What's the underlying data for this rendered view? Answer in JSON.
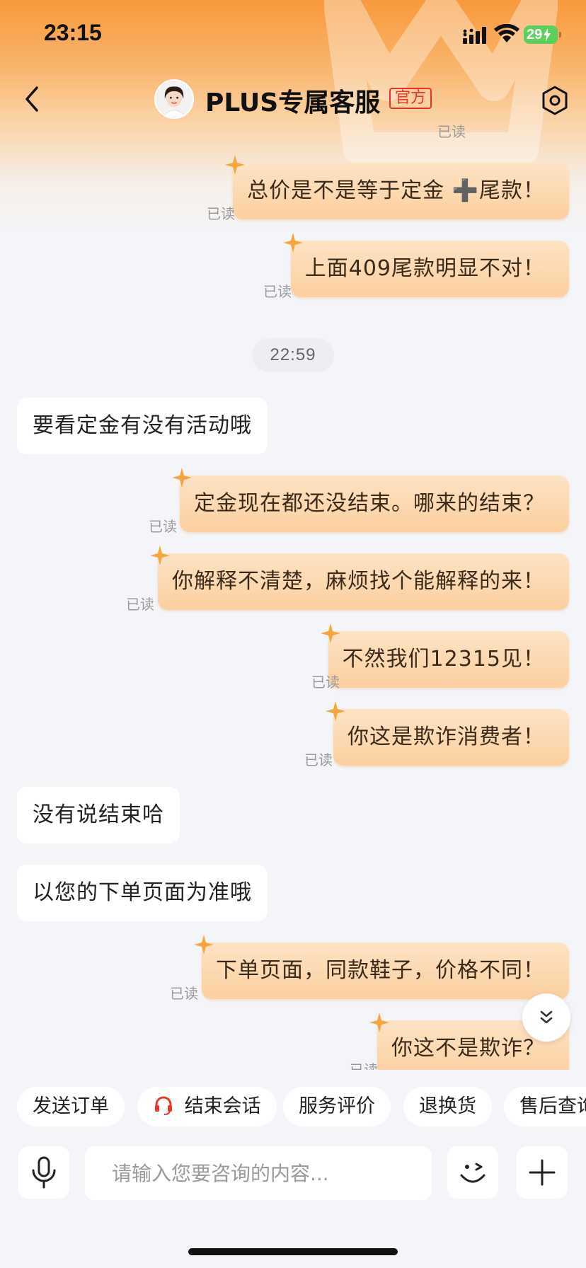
{
  "status_bar": {
    "time": "23:15",
    "battery": "29"
  },
  "header": {
    "title": "PLUS专属客服",
    "badge": "官方"
  },
  "chat": {
    "messages": [
      {
        "type": "out",
        "text": "总价是不是等于定金 ➕尾款！",
        "read": "已读"
      },
      {
        "type": "out",
        "text": "上面409尾款明显不对！",
        "read": "已读"
      },
      {
        "type": "time",
        "text": "22:59"
      },
      {
        "type": "in",
        "text": "要看定金有没有活动哦"
      },
      {
        "type": "out",
        "text": "定金现在都还没结束。哪来的结束？",
        "read": "已读"
      },
      {
        "type": "out",
        "text": "你解释不清楚，麻烦找个能解释的来！",
        "read": "已读"
      },
      {
        "type": "out",
        "text": "不然我们12315见！",
        "read": "已读"
      },
      {
        "type": "out",
        "text": "你这是欺诈消费者！",
        "read": "已读"
      },
      {
        "type": "in",
        "text": "没有说结束哈"
      },
      {
        "type": "in",
        "text": "以您的下单页面为准哦"
      },
      {
        "type": "out",
        "text": "下单页面，同款鞋子，价格不同！",
        "read": "已读"
      },
      {
        "type": "out",
        "text": "你这不是欺诈？",
        "read": "已读"
      }
    ],
    "top_partial_read": "已读"
  },
  "quick_actions": [
    {
      "label": "发送订单"
    },
    {
      "label": "结束会话",
      "icon": "headset-icon"
    },
    {
      "label": "服务评价"
    },
    {
      "label": "退换货"
    },
    {
      "label": "售后查询"
    }
  ],
  "input": {
    "placeholder": "请输入您要咨询的内容..."
  },
  "colors": {
    "accent": "#f79a3c",
    "bubble_out": "#fccf9f",
    "official_red": "#e8362c"
  }
}
